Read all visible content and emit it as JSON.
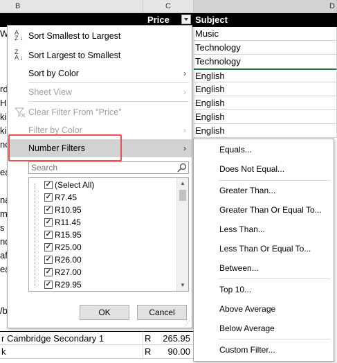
{
  "columns": {
    "b": "B",
    "c": "C",
    "d": "D"
  },
  "header": {
    "price": "Price",
    "subject": "Subject"
  },
  "subjects": [
    "Music",
    "Technology",
    "Technology",
    "English",
    "English",
    "English",
    "English",
    "English"
  ],
  "left_fragments": [
    "W",
    "rd",
    "Ho",
    "kil",
    "kil",
    "no",
    "ea",
    "na",
    "mp",
    "s V",
    "nd",
    "aff",
    "ea",
    "/b"
  ],
  "bottom_rows": [
    {
      "text": "r Cambridge Secondary 1",
      "currency": "R",
      "amount": "265.95"
    },
    {
      "text": "k",
      "currency": "R",
      "amount": "90.00"
    }
  ],
  "menu": {
    "sort_asc": "Sort Smallest to Largest",
    "sort_desc": "Sort Largest to Smallest",
    "sort_color": "Sort by Color",
    "sheet_view": "Sheet View",
    "clear_filter": "Clear Filter From \"Price\"",
    "filter_color": "Filter by Color",
    "number_filters": "Number Filters",
    "search_placeholder": "Search",
    "items": [
      "(Select All)",
      "R7.45",
      "R10.95",
      "R11.45",
      "R15.95",
      "R25.00",
      "R26.00",
      "R27.00",
      "R29.95"
    ],
    "ok": "OK",
    "cancel": "Cancel"
  },
  "submenu": {
    "equals": "Equals...",
    "not_equal": "Does Not Equal...",
    "greater": "Greater Than...",
    "greater_eq": "Greater Than Or Equal To...",
    "less": "Less Than...",
    "less_eq": "Less Than Or Equal To...",
    "between": "Between...",
    "top10": "Top 10...",
    "above_avg": "Above Average",
    "below_avg": "Below Average",
    "custom": "Custom Filter..."
  },
  "colors": {
    "highlight": "#e8514f",
    "hover": "#d2d2d2",
    "selected_border": "#217346"
  }
}
